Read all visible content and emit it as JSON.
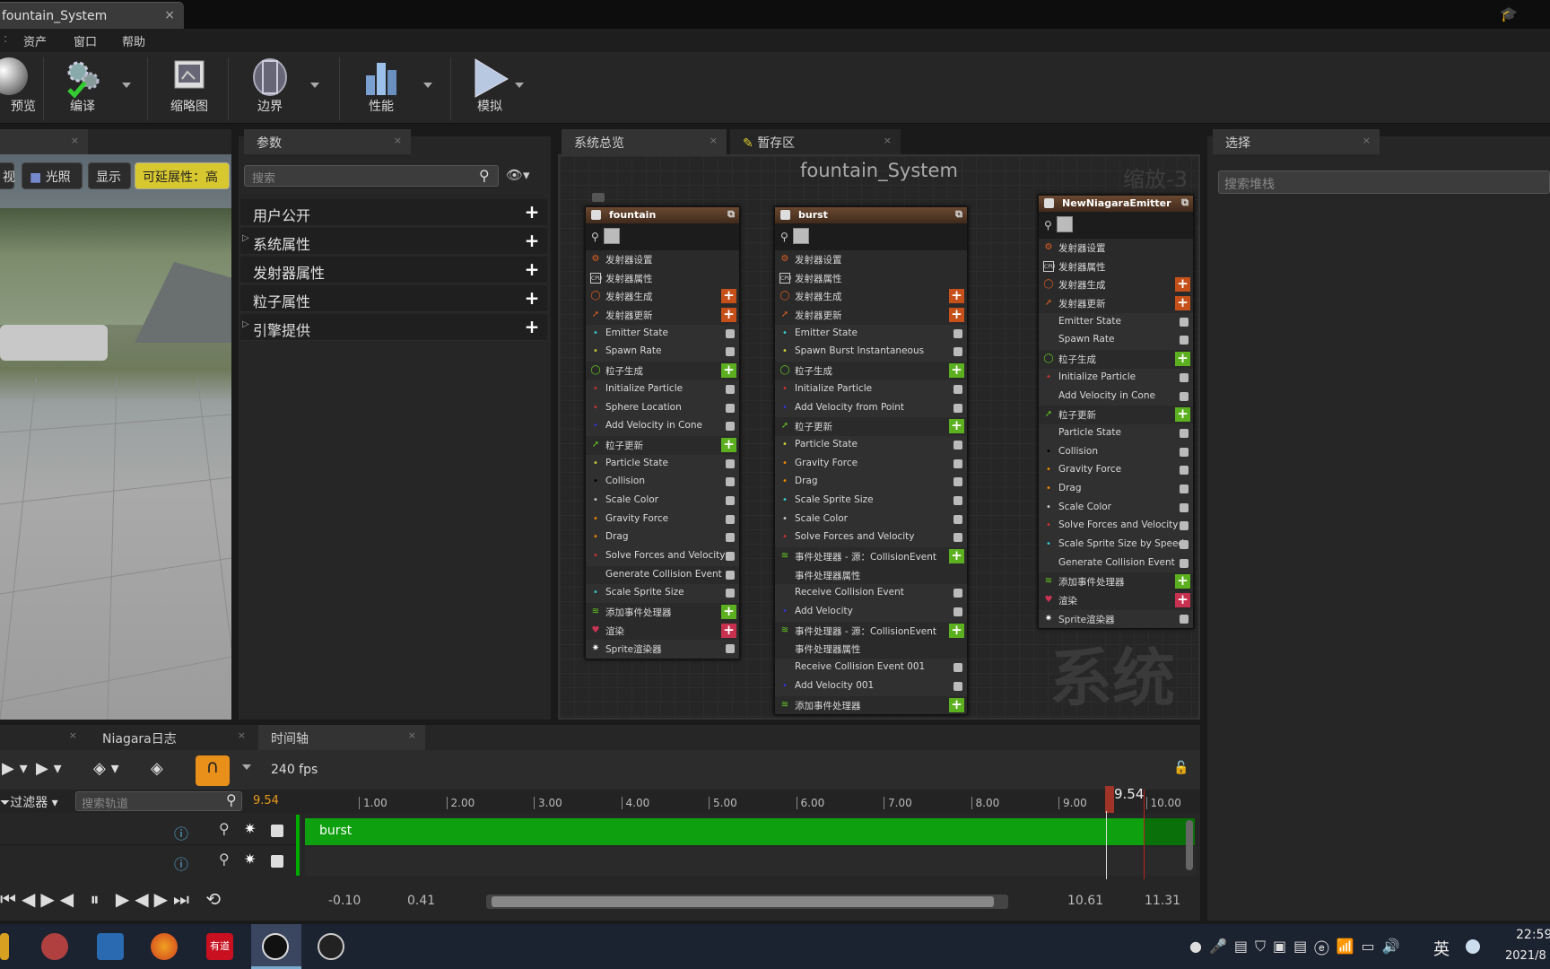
{
  "window": {
    "doc_tab": "fountain_System",
    "close": "×"
  },
  "menu": {
    "items": [
      "资产",
      "窗口",
      "帮助"
    ]
  },
  "toolbar": {
    "items": [
      "预览",
      "编译",
      "缩略图",
      "边界",
      "性能",
      "模拟"
    ]
  },
  "viewport": {
    "buttons": [
      "视",
      "光照",
      "显示",
      "可延展性：高"
    ]
  },
  "params": {
    "tab": "参数",
    "search_placeholder": "搜索",
    "rows": [
      "用户公开",
      "系统属性",
      "发射器属性",
      "粒子属性",
      "引擎提供"
    ]
  },
  "graph": {
    "tabs": [
      "系统总览",
      "暂存区"
    ],
    "title": "fountain_System",
    "zoom": "缩放-3",
    "watermark": "系统"
  },
  "nodes": [
    {
      "name": "fountain",
      "rows": [
        {
          "t": "发射器设置",
          "k": "sec",
          "i": "⚙",
          "c": "#e06020"
        },
        {
          "t": "发射器属性",
          "k": "sec",
          "i": "CPU",
          "c": "#ccc"
        },
        {
          "t": "发射器生成",
          "k": "sec",
          "i": "◯",
          "c": "#e06020",
          "a": "or"
        },
        {
          "t": "发射器更新",
          "k": "sec",
          "i": "➚",
          "c": "#e06020",
          "a": "or"
        },
        {
          "t": "Emitter State",
          "k": "mod",
          "i": "•",
          "c": "#3cc",
          "ck": 1
        },
        {
          "t": "Spawn Rate",
          "k": "mod",
          "i": "•",
          "c": "#cc3",
          "ck": 1
        },
        {
          "t": "粒子生成",
          "k": "sec",
          "i": "◯",
          "c": "#6c2",
          "a": "gr"
        },
        {
          "t": "Initialize Particle",
          "k": "mod",
          "i": "•",
          "c": "#c33",
          "ck": 1
        },
        {
          "t": "Sphere Location",
          "k": "mod",
          "i": "•",
          "c": "#c33",
          "ck": 1
        },
        {
          "t": "Add Velocity in Cone",
          "k": "mod",
          "i": "•",
          "c": "#33c",
          "ck": 1
        },
        {
          "t": "粒子更新",
          "k": "sec",
          "i": "➚",
          "c": "#6c2",
          "a": "gr"
        },
        {
          "t": "Particle State",
          "k": "mod",
          "i": "•",
          "c": "#cc3",
          "ck": 1
        },
        {
          "t": "Collision",
          "k": "mod",
          "i": "•",
          "c": "#000",
          "ck": 1
        },
        {
          "t": "Scale Color",
          "k": "mod",
          "i": "•",
          "c": "#ccc",
          "ck": 1
        },
        {
          "t": "Gravity Force",
          "k": "mod",
          "i": "•",
          "c": "#e80",
          "ck": 1
        },
        {
          "t": "Drag",
          "k": "mod",
          "i": "•",
          "c": "#e80",
          "ck": 1
        },
        {
          "t": "Solve Forces and Velocity",
          "k": "mod",
          "i": "•",
          "c": "#c33",
          "ck": 1
        },
        {
          "t": "Generate Collision Event",
          "k": "sec",
          "i": "",
          "c": "#ccc",
          "ck": 1
        },
        {
          "t": "Scale Sprite Size",
          "k": "mod",
          "i": "•",
          "c": "#3cc",
          "ck": 1
        },
        {
          "t": "添加事件处理器",
          "k": "sec",
          "i": "≋",
          "c": "#6c2",
          "a": "gr"
        },
        {
          "t": "渲染",
          "k": "sec",
          "i": "♥",
          "c": "#c35",
          "a": "rd"
        },
        {
          "t": "Sprite渲染器",
          "k": "mod",
          "i": "✷",
          "c": "#fff",
          "ck": 1
        }
      ]
    },
    {
      "name": "burst",
      "rows": [
        {
          "t": "发射器设置",
          "k": "sec",
          "i": "⚙",
          "c": "#e06020"
        },
        {
          "t": "发射器属性",
          "k": "sec",
          "i": "CPU",
          "c": "#ccc"
        },
        {
          "t": "发射器生成",
          "k": "sec",
          "i": "◯",
          "c": "#e06020",
          "a": "or"
        },
        {
          "t": "发射器更新",
          "k": "sec",
          "i": "➚",
          "c": "#e06020",
          "a": "or"
        },
        {
          "t": "Emitter State",
          "k": "mod",
          "i": "•",
          "c": "#3cc",
          "ck": 1
        },
        {
          "t": "Spawn Burst Instantaneous",
          "k": "mod",
          "i": "•",
          "c": "#cc3",
          "ck": 1
        },
        {
          "t": "粒子生成",
          "k": "sec",
          "i": "◯",
          "c": "#6c2",
          "a": "gr"
        },
        {
          "t": "Initialize Particle",
          "k": "mod",
          "i": "•",
          "c": "#c33",
          "ck": 1
        },
        {
          "t": "Add Velocity from Point",
          "k": "mod",
          "i": "•",
          "c": "#33c",
          "ck": 1
        },
        {
          "t": "粒子更新",
          "k": "sec",
          "i": "➚",
          "c": "#6c2",
          "a": "gr"
        },
        {
          "t": "Particle State",
          "k": "mod",
          "i": "•",
          "c": "#cc3",
          "ck": 1
        },
        {
          "t": "Gravity Force",
          "k": "mod",
          "i": "•",
          "c": "#e80",
          "ck": 1
        },
        {
          "t": "Drag",
          "k": "mod",
          "i": "•",
          "c": "#e80",
          "ck": 1
        },
        {
          "t": "Scale Sprite Size",
          "k": "mod",
          "i": "•",
          "c": "#3cc",
          "ck": 1
        },
        {
          "t": "Scale Color",
          "k": "mod",
          "i": "•",
          "c": "#ccc",
          "ck": 1
        },
        {
          "t": "Solve Forces and Velocity",
          "k": "mod",
          "i": "•",
          "c": "#c33",
          "ck": 1
        },
        {
          "t": "事件处理器 - 源：CollisionEvent",
          "k": "sec",
          "i": "≋",
          "c": "#6c2",
          "a": "gr"
        },
        {
          "t": "事件处理器属性",
          "k": "sec",
          "i": "",
          "c": "#ccc"
        },
        {
          "t": "Receive Collision Event",
          "k": "mod",
          "i": "",
          "c": "#ccc",
          "ck": 1
        },
        {
          "t": "Add Velocity",
          "k": "mod",
          "i": "•",
          "c": "#33c",
          "ck": 1
        },
        {
          "t": "事件处理器 - 源：CollisionEvent",
          "k": "sec",
          "i": "≋",
          "c": "#6c2",
          "a": "gr"
        },
        {
          "t": "事件处理器属性",
          "k": "sec",
          "i": "",
          "c": "#ccc"
        },
        {
          "t": "Receive Collision Event 001",
          "k": "mod",
          "i": "",
          "c": "#ccc",
          "ck": 1
        },
        {
          "t": "Add Velocity 001",
          "k": "mod",
          "i": "•",
          "c": "#33c",
          "ck": 1
        },
        {
          "t": "添加事件处理器",
          "k": "sec",
          "i": "≋",
          "c": "#6c2",
          "a": "gr"
        }
      ]
    },
    {
      "name": "NewNiagaraEmitter",
      "rows": [
        {
          "t": "发射器设置",
          "k": "sec",
          "i": "⚙",
          "c": "#e06020"
        },
        {
          "t": "发射器属性",
          "k": "sec",
          "i": "CPU",
          "c": "#ccc"
        },
        {
          "t": "发射器生成",
          "k": "sec",
          "i": "◯",
          "c": "#e06020",
          "a": "or"
        },
        {
          "t": "发射器更新",
          "k": "sec",
          "i": "➚",
          "c": "#e06020",
          "a": "or"
        },
        {
          "t": "Emitter State",
          "k": "mod",
          "i": "",
          "c": "#ccc",
          "ck": 1
        },
        {
          "t": "Spawn Rate",
          "k": "mod",
          "i": "",
          "c": "#ccc",
          "ck": 1
        },
        {
          "t": "粒子生成",
          "k": "sec",
          "i": "◯",
          "c": "#6c2",
          "a": "gr"
        },
        {
          "t": "Initialize Particle",
          "k": "mod",
          "i": "•",
          "c": "#c33",
          "ck": 1
        },
        {
          "t": "Add Velocity in Cone",
          "k": "mod",
          "i": "",
          "c": "#ccc",
          "ck": 1
        },
        {
          "t": "粒子更新",
          "k": "sec",
          "i": "➚",
          "c": "#6c2",
          "a": "gr"
        },
        {
          "t": "Particle State",
          "k": "mod",
          "i": "",
          "c": "#ccc",
          "ck": 1
        },
        {
          "t": "Collision",
          "k": "mod",
          "i": "•",
          "c": "#000",
          "ck": 1
        },
        {
          "t": "Gravity Force",
          "k": "mod",
          "i": "•",
          "c": "#e80",
          "ck": 1
        },
        {
          "t": "Drag",
          "k": "mod",
          "i": "•",
          "c": "#e80",
          "ck": 1
        },
        {
          "t": "Scale Color",
          "k": "mod",
          "i": "•",
          "c": "#ccc",
          "ck": 1
        },
        {
          "t": "Solve Forces and Velocity",
          "k": "mod",
          "i": "•",
          "c": "#c33",
          "ck": 1
        },
        {
          "t": "Scale Sprite Size by Speed",
          "k": "mod",
          "i": "•",
          "c": "#3cc",
          "ck": 1
        },
        {
          "t": "Generate Collision Event",
          "k": "mod",
          "i": "",
          "c": "#ccc",
          "ck": 1
        },
        {
          "t": "添加事件处理器",
          "k": "sec",
          "i": "≋",
          "c": "#6c2",
          "a": "gr"
        },
        {
          "t": "渲染",
          "k": "sec",
          "i": "♥",
          "c": "#c35",
          "a": "rd"
        },
        {
          "t": "Sprite渲染器",
          "k": "mod",
          "i": "✷",
          "c": "#fff",
          "ck": 1
        }
      ]
    }
  ],
  "timeline": {
    "tabs": [
      "Niagara日志",
      "时间轴"
    ],
    "fps": "240 fps",
    "filter": "过滤器",
    "search_placeholder": "搜索轨道",
    "time": "9.54",
    "marker": "9.54",
    "ticks": [
      "1.00",
      "2.00",
      "3.00",
      "4.00",
      "5.00",
      "6.00",
      "7.00",
      "8.00",
      "9.00",
      "10.00"
    ],
    "track": "burst",
    "range": [
      "-0.10",
      "0.41",
      "10.61",
      "11.31"
    ],
    "info": "ⓘ"
  },
  "select": {
    "tab": "选择",
    "search_placeholder": "搜索堆栈"
  },
  "taskbar": {
    "ime": "英",
    "clock": "22:59",
    "date": "2021/8"
  }
}
